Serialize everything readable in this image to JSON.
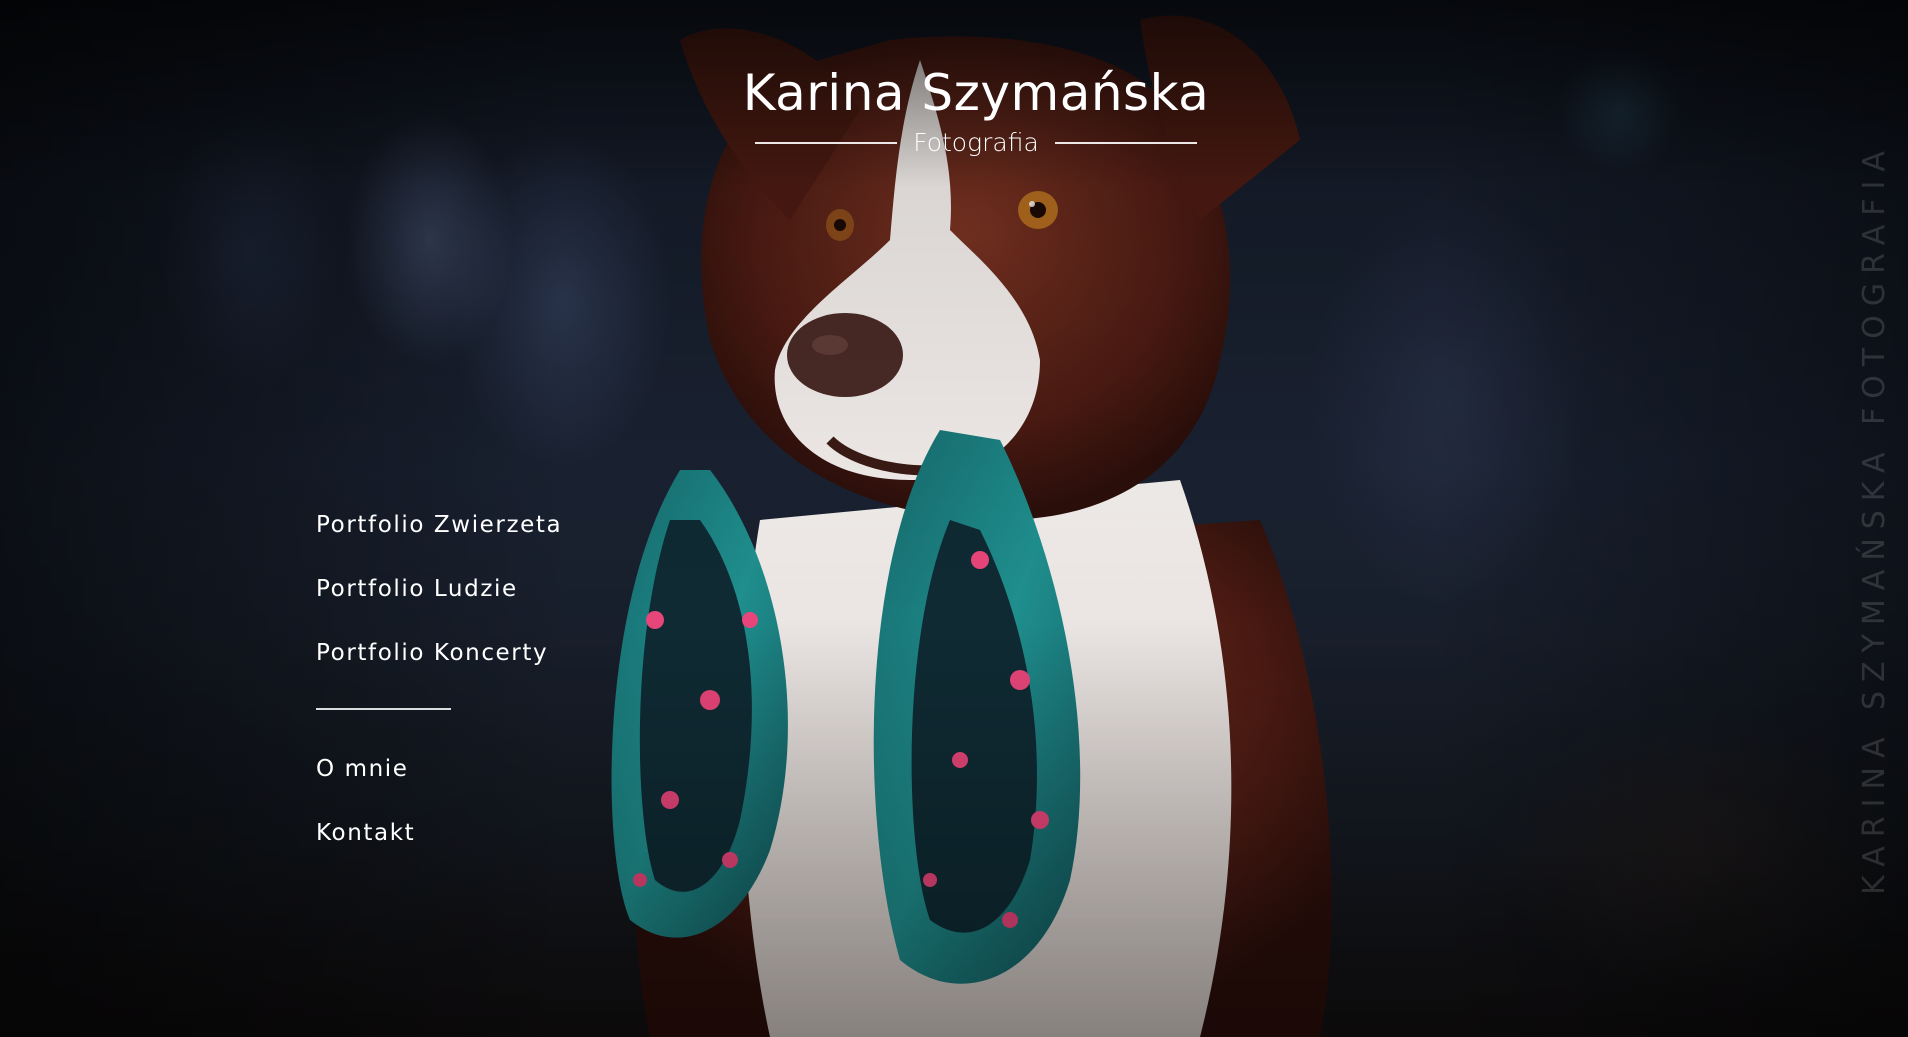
{
  "brand": {
    "name": "Karina Szymańska",
    "subtitle": "Fotografia"
  },
  "nav": {
    "items": [
      {
        "label": "Portfolio Zwierzeta"
      },
      {
        "label": "Portfolio Ludzie"
      },
      {
        "label": "Portfolio Koncerty"
      },
      {
        "label": "O mnie"
      },
      {
        "label": "Kontakt"
      }
    ]
  },
  "side_watermark": "KARINA SZYMAŃSKA FOTOGRAFIA",
  "colors": {
    "text": "#ffffff",
    "background": "#151a22",
    "fur_brown": "#5a2218",
    "leash_teal": "#1e8a8a",
    "flower_pink": "#e8457a"
  }
}
